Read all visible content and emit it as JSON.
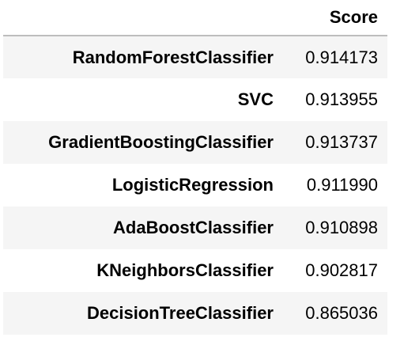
{
  "table": {
    "columns": [
      "",
      "Score"
    ],
    "rows": [
      {
        "name": "RandomForestClassifier",
        "score": "0.914173"
      },
      {
        "name": "SVC",
        "score": "0.913955"
      },
      {
        "name": "GradientBoostingClassifier",
        "score": "0.913737"
      },
      {
        "name": "LogisticRegression",
        "score": "0.911990"
      },
      {
        "name": "AdaBoostClassifier",
        "score": "0.910898"
      },
      {
        "name": "KNeighborsClassifier",
        "score": "0.902817"
      },
      {
        "name": "DecisionTreeClassifier",
        "score": "0.865036"
      }
    ]
  },
  "colors": {
    "odd_row_bg": "#f5f5f5",
    "header_border": "#bdbdbd"
  }
}
